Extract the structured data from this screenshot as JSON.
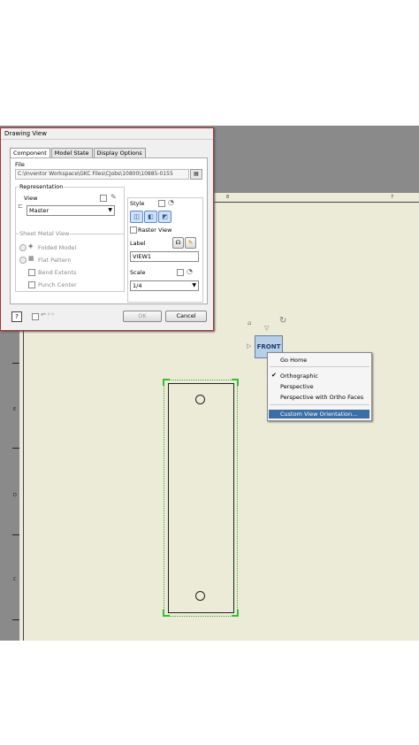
{
  "dialog": {
    "title": "Drawing View",
    "tabs": [
      "Component",
      "Model State",
      "Display Options"
    ],
    "file_label": "File",
    "file_path": "C:\\Inventor Workspace\\GKC Files\\CJobs\\10800\\10885-0155",
    "representation_label": "Representation",
    "view_label": "View",
    "view_value": "Master",
    "sheet_metal_label": "Sheet Metal View",
    "folded_model": "Folded Model",
    "flat_pattern": "Flat Pattern",
    "bend_extents": "Bend Extents",
    "punch_center": "Punch Center",
    "style_label": "Style",
    "raster_view": "Raster View",
    "label_label": "Label",
    "label_value": "VIEW1",
    "scale_label": "Scale",
    "scale_value": "1/4",
    "ok": "OK",
    "cancel": "Cancel",
    "help": "?"
  },
  "view_cube": {
    "face": "FRONT"
  },
  "context_menu": {
    "items": [
      "Go Home",
      "Orthographic",
      "Perspective",
      "Perspective with Ortho Faces",
      "Custom View Orientation..."
    ],
    "checked": "Orthographic"
  },
  "sheet": {
    "top_ticks": [
      "8",
      "7"
    ],
    "side_ticks": [
      "E",
      "D",
      "C"
    ]
  },
  "colors": {
    "accent": "#3a6ea5",
    "selection": "#37b437",
    "sheet": "#ecebd8"
  }
}
